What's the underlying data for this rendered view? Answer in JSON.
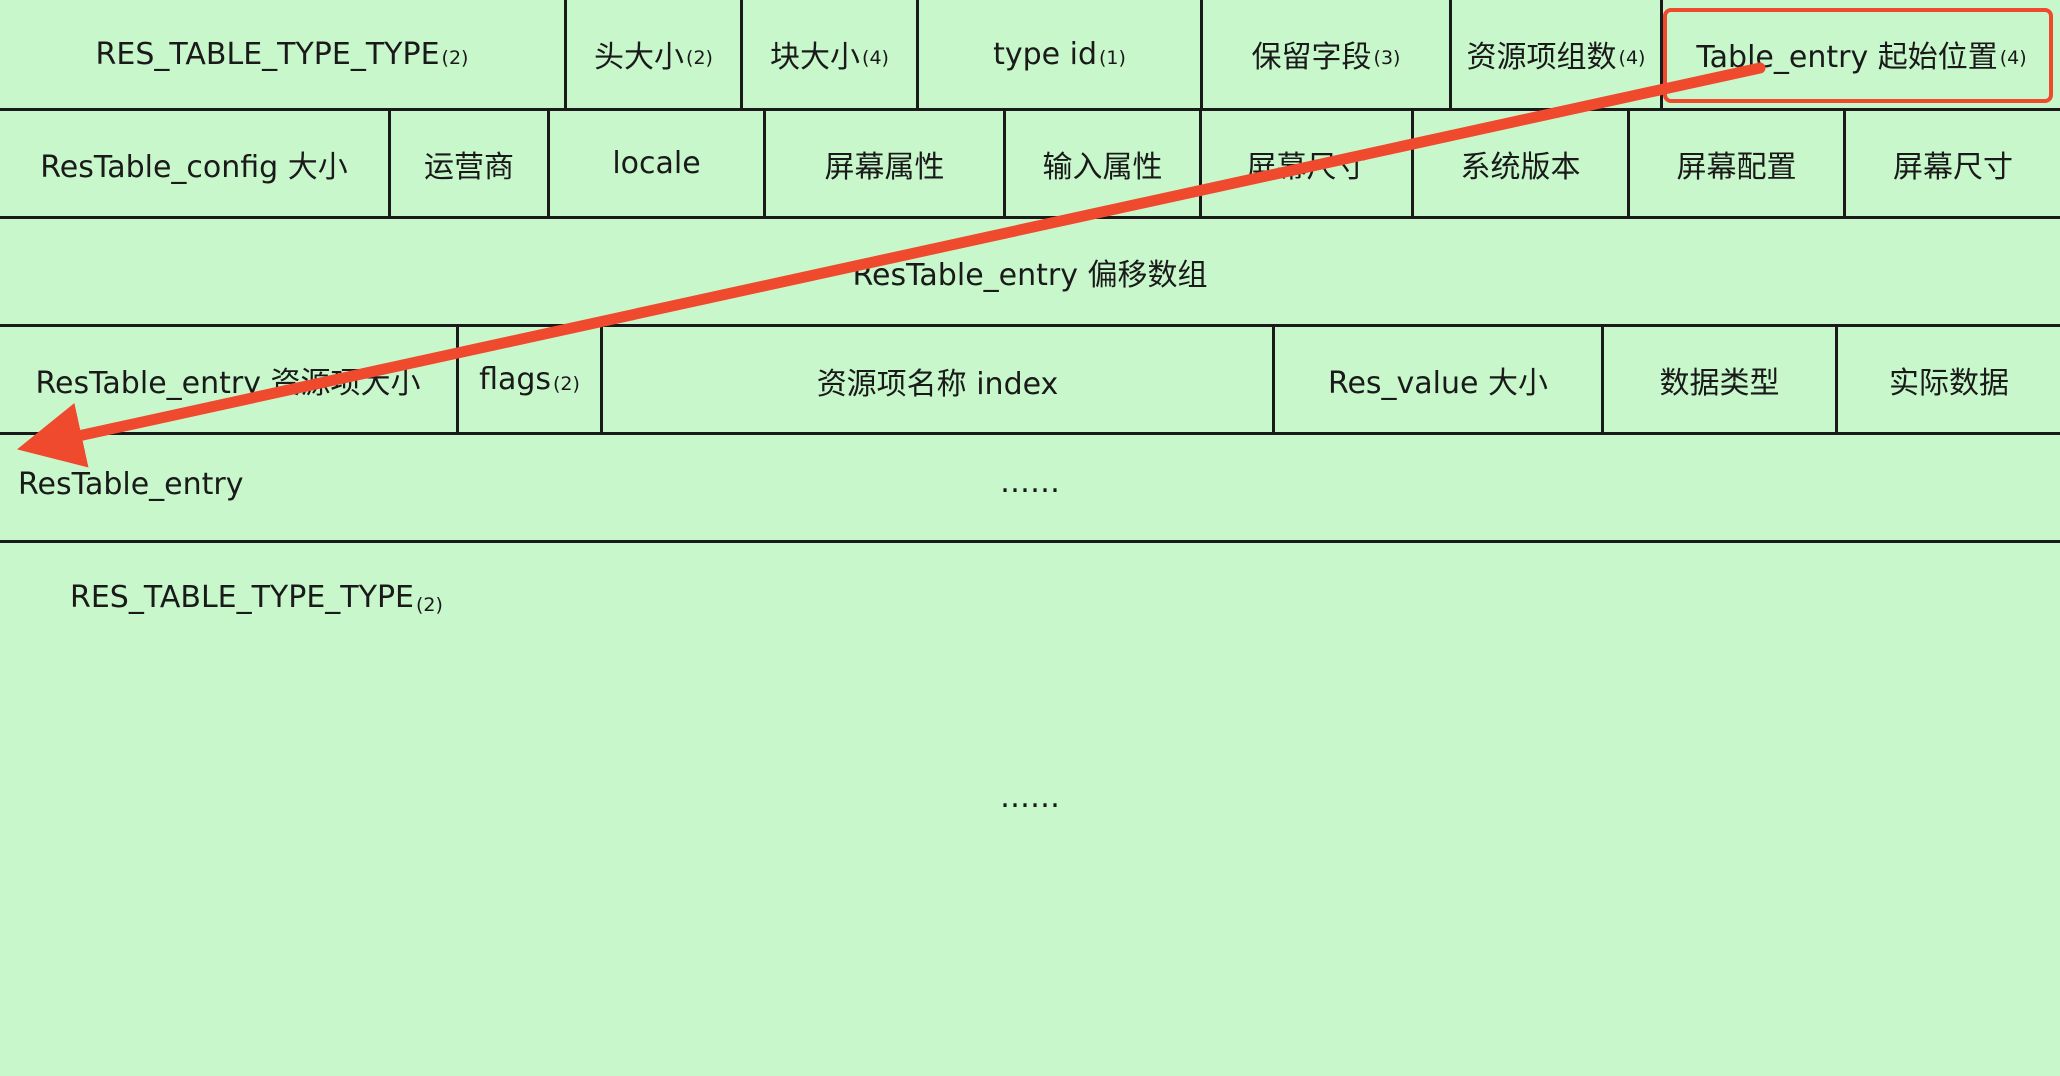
{
  "header_row": [
    {
      "label": "RES_TABLE_TYPE_TYPE",
      "size": "(2)"
    },
    {
      "label": "头大小",
      "size": "(2)"
    },
    {
      "label": "块大小",
      "size": "(4)"
    },
    {
      "label": "type id",
      "size": "(1)"
    },
    {
      "label": "保留字段",
      "size": "(3)"
    },
    {
      "label": "资源项组数",
      "size": "(4)"
    },
    {
      "label": "Table_entry 起始位置",
      "size": "(4)"
    }
  ],
  "config_row": [
    {
      "label": "ResTable_config 大小"
    },
    {
      "label": "运营商"
    },
    {
      "label": "locale"
    },
    {
      "label": "屏幕属性"
    },
    {
      "label": "输入属性"
    },
    {
      "label": "屏幕尺寸"
    },
    {
      "label": "系统版本"
    },
    {
      "label": "屏幕配置"
    },
    {
      "label": "屏幕尺寸"
    }
  ],
  "offset_row": {
    "label": "ResTable_entry 偏移数组"
  },
  "entry_row": [
    {
      "label": "ResTable_entry 资源项大小",
      "size": ""
    },
    {
      "label": "flags",
      "size": "(2)"
    },
    {
      "label": "资源项名称 index",
      "size": ""
    },
    {
      "label": "Res_value 大小",
      "size": ""
    },
    {
      "label": "数据类型",
      "size": ""
    },
    {
      "label": "实际数据",
      "size": ""
    }
  ],
  "entry_more_row": {
    "label": "ResTable_entry",
    "ellipsis": "……"
  },
  "next_chunk": {
    "label": "RES_TABLE_TYPE_TYPE",
    "size": "(2)",
    "ellipsis": "……"
  },
  "colors": {
    "background": "#c8f7cc",
    "border": "#1a1a1a",
    "highlight": "#f04a2e"
  }
}
